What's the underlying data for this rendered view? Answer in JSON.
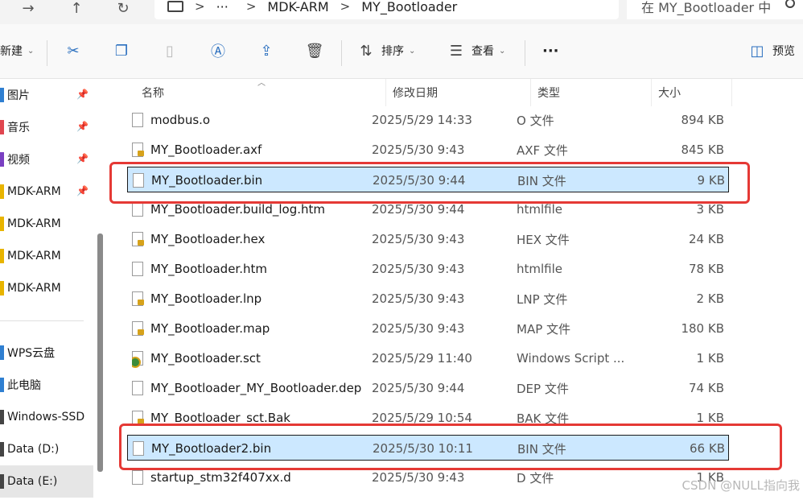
{
  "nav": {
    "back_icon": "back-arrow-icon",
    "up_icon": "up-arrow-icon",
    "refresh_icon": "refresh-icon"
  },
  "address": {
    "sep": ">",
    "more": "···",
    "crumbs": [
      "MDK-ARM",
      "MY_Bootloader"
    ]
  },
  "search": {
    "placeholder": "在 MY_Bootloader 中搜索"
  },
  "toolbar": {
    "new_label": "新建",
    "sort_label": "排序",
    "view_label": "查看",
    "more_label": "···",
    "preview_label": "预览"
  },
  "sidebar": {
    "items": [
      {
        "label": "图片",
        "pinned": true,
        "color": "#2f7fd1"
      },
      {
        "label": "音乐",
        "pinned": true,
        "color": "#e0464f"
      },
      {
        "label": "视频",
        "pinned": true,
        "color": "#7a3fc2"
      },
      {
        "label": "MDK-ARM",
        "pinned": true,
        "color": "#e8b400"
      },
      {
        "label": "MDK-ARM",
        "pinned": false,
        "color": "#e8b400"
      },
      {
        "label": "MDK-ARM",
        "pinned": false,
        "color": "#e8b400"
      },
      {
        "label": "MDK-ARM",
        "pinned": false,
        "color": "#e8b400"
      },
      {
        "label": "WPS云盘",
        "pinned": false,
        "color": "#2f7fd1"
      },
      {
        "label": "此电脑",
        "pinned": false,
        "color": "#2f7fd1"
      },
      {
        "label": "Windows-SSD",
        "pinned": false,
        "color": "#444444"
      },
      {
        "label": "Data (D:)",
        "pinned": false,
        "color": "#444444"
      },
      {
        "label": "Data (E:)",
        "pinned": false,
        "color": "#444444"
      }
    ]
  },
  "columns": {
    "name": "名称",
    "date": "修改日期",
    "type": "类型",
    "size": "大小"
  },
  "files": [
    {
      "name": "modbus.o",
      "date": "2025/5/29 14:33",
      "type": "O 文件",
      "size": "894 KB",
      "icon": "plain"
    },
    {
      "name": "MY_Bootloader.axf",
      "date": "2025/5/30 9:43",
      "type": "AXF 文件",
      "size": "845 KB",
      "icon": "lock"
    },
    {
      "name": "MY_Bootloader.bin",
      "date": "2025/5/30 9:44",
      "type": "BIN 文件",
      "size": "9 KB",
      "icon": "plain",
      "selected": true
    },
    {
      "name": "MY_Bootloader.build_log.htm",
      "date": "2025/5/30 9:44",
      "type": "htmlfile",
      "size": "3 KB",
      "icon": "plain"
    },
    {
      "name": "MY_Bootloader.hex",
      "date": "2025/5/30 9:43",
      "type": "HEX 文件",
      "size": "24 KB",
      "icon": "lock"
    },
    {
      "name": "MY_Bootloader.htm",
      "date": "2025/5/30 9:43",
      "type": "htmlfile",
      "size": "78 KB",
      "icon": "plain"
    },
    {
      "name": "MY_Bootloader.lnp",
      "date": "2025/5/30 9:43",
      "type": "LNP 文件",
      "size": "2 KB",
      "icon": "lock"
    },
    {
      "name": "MY_Bootloader.map",
      "date": "2025/5/30 9:43",
      "type": "MAP 文件",
      "size": "180 KB",
      "icon": "lock"
    },
    {
      "name": "MY_Bootloader.sct",
      "date": "2025/5/29 11:40",
      "type": "Windows Script ...",
      "size": "1 KB",
      "icon": "script"
    },
    {
      "name": "MY_Bootloader_MY_Bootloader.dep",
      "date": "2025/5/30 9:44",
      "type": "DEP 文件",
      "size": "74 KB",
      "icon": "plain"
    },
    {
      "name": "MY_Bootloader_sct.Bak",
      "date": "2025/5/29 10:54",
      "type": "BAK 文件",
      "size": "1 KB",
      "icon": "lock"
    },
    {
      "name": "MY_Bootloader2.bin",
      "date": "2025/5/30 10:11",
      "type": "BIN 文件",
      "size": "66 KB",
      "icon": "plain",
      "selected": true
    },
    {
      "name": "startup_stm32f407xx.d",
      "date": "2025/5/30 9:43",
      "type": "D 文件",
      "size": "1 KB",
      "icon": "plain"
    }
  ],
  "watermark": "CSDN @NULL指向我",
  "colors": {
    "selection": "#cce8ff",
    "highlight_box": "#e53935",
    "accent": "#2a6fbf"
  }
}
